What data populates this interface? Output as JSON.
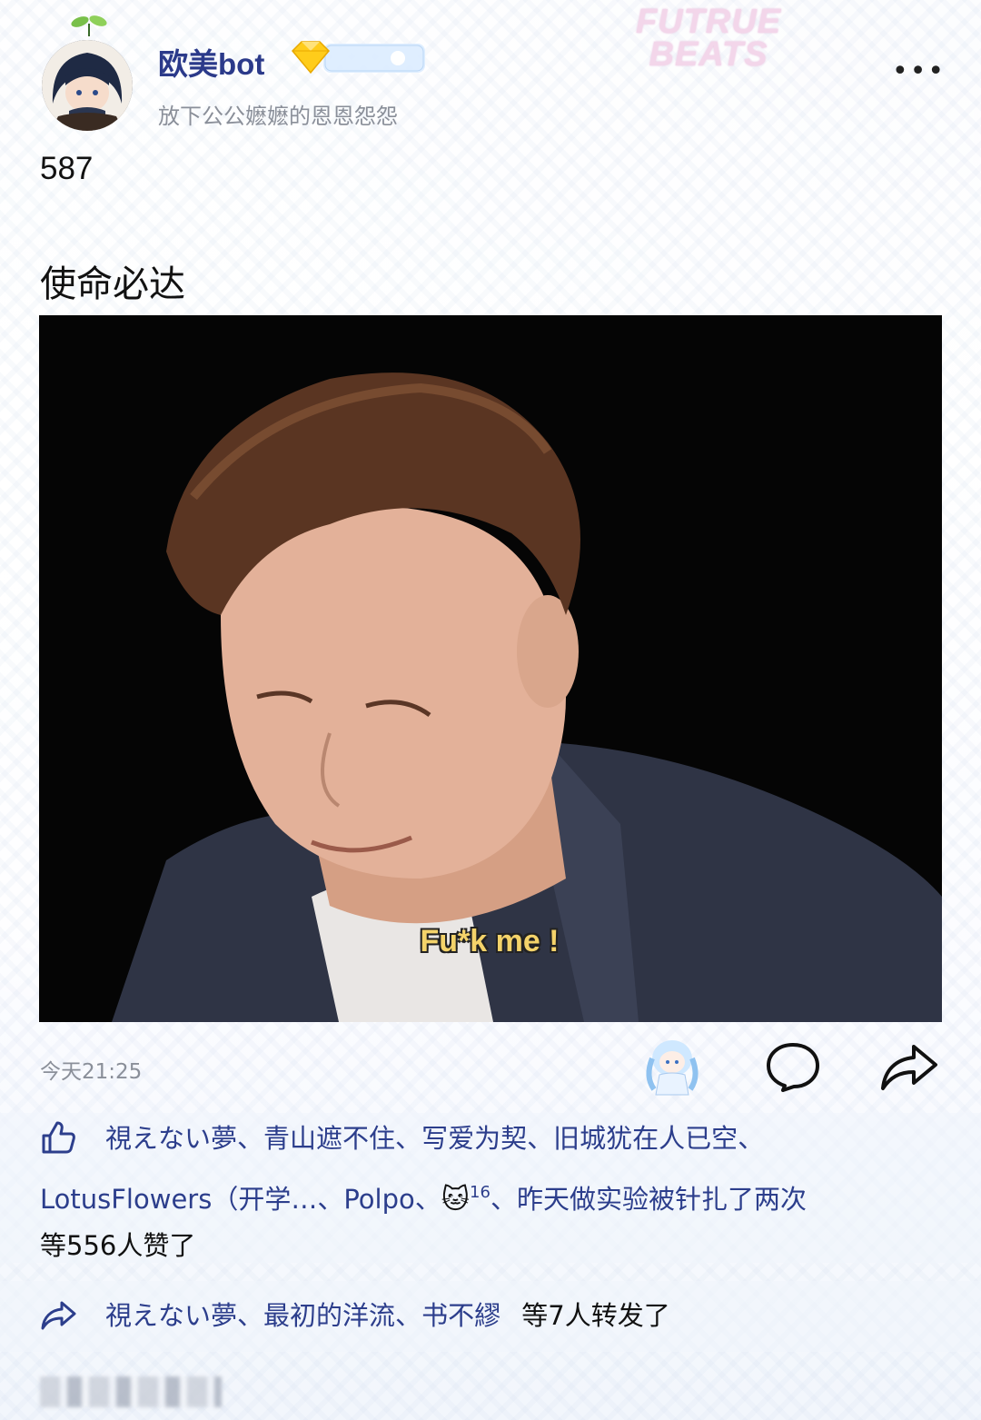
{
  "header": {
    "username": "欧美bot",
    "bio": "放下公公嬷嬷的恩恩怨怨",
    "banner_logo": [
      "FUTRUE",
      "BEATS"
    ],
    "more_label": "•••"
  },
  "post": {
    "number": "587",
    "title": "使命必达",
    "image_subtitle": "Fu*k me !",
    "timestamp": "今天21:25"
  },
  "likes": {
    "line1": [
      "視えない夢",
      "、",
      "青山遮不住",
      "、",
      "写爱为契",
      "、",
      "旧城犹在人已空",
      "、"
    ],
    "line2_a": "LotusFlowers（开学…",
    "line2_sep1": "、",
    "line2_b": "Polpo",
    "line2_sep2": "、",
    "line2_cat": "🐱",
    "line2_sup": "16",
    "line2_sep3": "、",
    "line2_c": "昨天做实验被针扎了两次",
    "summary": "等556人赞了"
  },
  "reposts": {
    "names": [
      "視えない夢",
      "、",
      "最初的洋流",
      "、",
      "书不繆"
    ],
    "summary": "等7人转发了"
  },
  "icons": {
    "like": "thumbs-up-icon",
    "repost": "share-arrow-icon",
    "comment": "speech-bubble-icon",
    "more": "ellipsis-icon"
  }
}
